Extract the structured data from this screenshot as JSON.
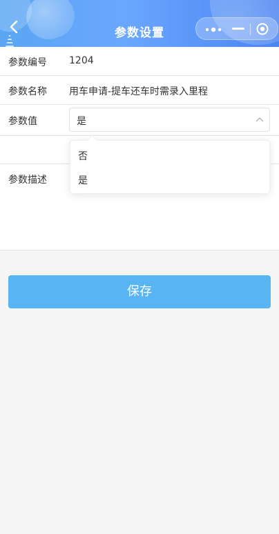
{
  "header": {
    "title": "参数设置",
    "back_icon": "chevron-left-icon",
    "capsule": {
      "more_icon": "more-dots-icon",
      "minimize_icon": "minimize-icon",
      "close_icon": "record-circle-icon"
    },
    "gradient": [
      "#5aa6f2",
      "#4b83f0"
    ]
  },
  "form": {
    "fields": [
      {
        "label": "参数编号",
        "value": "1204"
      },
      {
        "label": "参数名称",
        "value": "用车申请-提车还车时需录入里程"
      },
      {
        "label": "参数值",
        "value": "是"
      },
      {
        "label": "参数描述",
        "value": ""
      }
    ],
    "select": {
      "selected": "是",
      "chevron_icon": "chevron-up-icon",
      "options": [
        "否",
        "是"
      ]
    }
  },
  "actions": {
    "save_label": "保存",
    "save_color": "#58b4f2"
  }
}
